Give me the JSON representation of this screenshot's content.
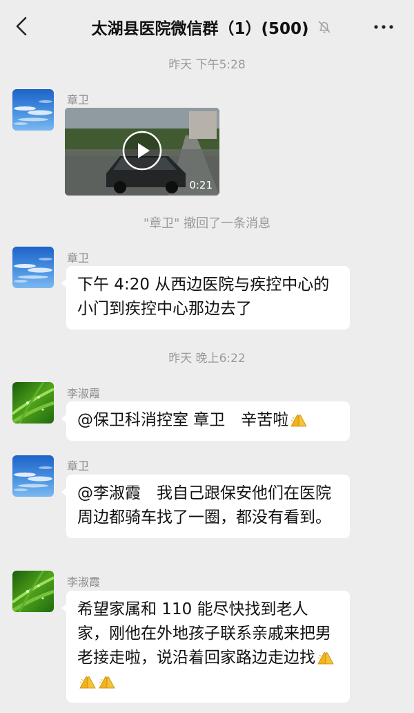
{
  "header": {
    "title": "太湖县医院微信群（1）(500)"
  },
  "chat": {
    "time1": "昨天 下午5:28",
    "msg1": {
      "sender": "章卫",
      "video_duration": "0:21"
    },
    "recall": "\"章卫\" 撤回了一条消息",
    "msg2": {
      "sender": "章卫",
      "text": "下午 4:20 从西边医院与疾控中心的小门到疾控中心那边去了"
    },
    "time2": "昨天 晚上6:22",
    "msg3": {
      "sender": "李淑霞",
      "text": "@保卫科消控室 章卫　辛苦啦"
    },
    "msg4": {
      "sender": "章卫",
      "text": "@李淑霞　我自己跟保安他们在医院周边都骑车找了一圈，都没有看到。"
    },
    "msg5": {
      "sender": "李淑霞",
      "text": "希望家属和 110 能尽快找到老人家，刚他在外地孩子联系亲戚来把男老接走啦，说沿着回家路边走边找"
    }
  },
  "icons": {
    "back": "chevron-left-icon",
    "mute": "bell-off-icon",
    "more": "more-dots-icon",
    "play": "play-icon",
    "emoji": "praying-hands-emoji"
  }
}
